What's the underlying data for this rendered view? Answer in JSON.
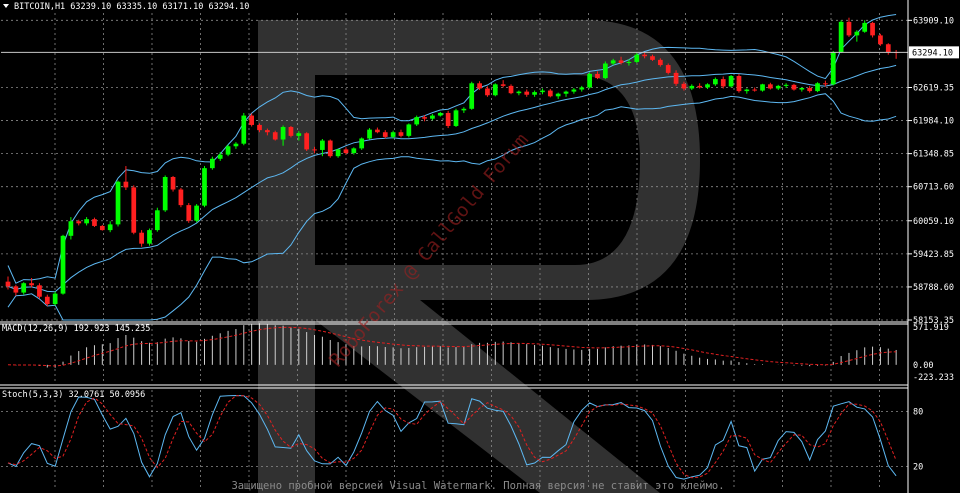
{
  "colors": {
    "background": "#000000",
    "grid": "#8a8a8a",
    "axis_text": "#ffffff",
    "bull": "#00ff00",
    "bear": "#ff2020",
    "bands": "#5db8f2",
    "macd_hist": "#d0d0d0",
    "macd_signal": "#e02020",
    "stoch_main": "#5db8f2",
    "stoch_signal": "#e02020",
    "price_line": "#c8c8c8",
    "watermark_logo": "#3a3a3a",
    "watermark_text": "#a02020"
  },
  "panels": {
    "price": {
      "header": "BITCOIN,H1  63239.10 63335.10 63171.10 63294.10",
      "current_price_label": "63294.10",
      "axis_ticks": [
        "63909.10",
        "62619.35",
        "61984.10",
        "61348.85",
        "60713.60",
        "60059.10",
        "59423.85",
        "58788.60",
        "58153.35"
      ]
    },
    "macd": {
      "header": "MACD(12,26,9) 192.923 145.235",
      "axis_ticks": [
        "571.919",
        "0.00",
        "-223.233"
      ]
    },
    "stoch": {
      "header": "Stoch(5,3,3) 32.0761 50.0956",
      "axis_ticks": [
        "80",
        "20"
      ]
    }
  },
  "watermark": {
    "diagonal_text": "RoboForex @ CallGold Forum",
    "footer_text": "Защищено пробной версией Visual Watermark. Полная версия не ставит это клеймо."
  },
  "chart_data": {
    "type": "candlestick",
    "symbol": "BITCOIN",
    "timeframe": "H1",
    "ylim": [
      58153.35,
      64050
    ],
    "candles": [
      [
        58890,
        58990,
        58740,
        58800
      ],
      [
        58800,
        58830,
        58620,
        58680
      ],
      [
        58680,
        58880,
        58640,
        58860
      ],
      [
        58860,
        58960,
        58780,
        58820
      ],
      [
        58820,
        58860,
        58560,
        58600
      ],
      [
        58600,
        58640,
        58420,
        58460
      ],
      [
        58460,
        58700,
        58430,
        58660
      ],
      [
        58660,
        59790,
        58640,
        59770
      ],
      [
        59770,
        60130,
        59700,
        60050
      ],
      [
        60050,
        60080,
        59970,
        60010
      ],
      [
        60010,
        60130,
        59970,
        60090
      ],
      [
        60090,
        60120,
        59940,
        59960
      ],
      [
        59960,
        59980,
        59870,
        59880
      ],
      [
        59880,
        60050,
        59840,
        59990
      ],
      [
        59990,
        60830,
        59950,
        60810
      ],
      [
        60810,
        61110,
        60650,
        60700
      ],
      [
        60700,
        60740,
        59800,
        59830
      ],
      [
        59830,
        59880,
        59560,
        59620
      ],
      [
        59620,
        59910,
        59580,
        59880
      ],
      [
        59880,
        60310,
        59850,
        60260
      ],
      [
        60260,
        60930,
        60230,
        60900
      ],
      [
        60900,
        60920,
        60620,
        60660
      ],
      [
        60660,
        60690,
        60320,
        60360
      ],
      [
        60360,
        60400,
        60020,
        60060
      ],
      [
        60060,
        60380,
        60030,
        60350
      ],
      [
        60350,
        61110,
        60320,
        61070
      ],
      [
        61070,
        61290,
        61040,
        61250
      ],
      [
        61250,
        61380,
        61210,
        61330
      ],
      [
        61330,
        61520,
        61300,
        61490
      ],
      [
        61490,
        61570,
        61440,
        61540
      ],
      [
        61540,
        62130,
        61510,
        62080
      ],
      [
        62080,
        62120,
        61870,
        61900
      ],
      [
        61900,
        61930,
        61760,
        61800
      ],
      [
        61800,
        61830,
        61700,
        61760
      ],
      [
        61760,
        61790,
        61600,
        61620
      ],
      [
        61620,
        61890,
        61500,
        61860
      ],
      [
        61860,
        61880,
        61660,
        61690
      ],
      [
        61690,
        61780,
        61600,
        61740
      ],
      [
        61740,
        61760,
        61400,
        61430
      ],
      [
        61430,
        61480,
        61360,
        61420
      ],
      [
        61420,
        61630,
        61300,
        61600
      ],
      [
        61600,
        61620,
        61270,
        61300
      ],
      [
        61300,
        61440,
        61270,
        61430
      ],
      [
        61430,
        61470,
        61330,
        61360
      ],
      [
        61360,
        61470,
        61330,
        61450
      ],
      [
        61450,
        61660,
        61420,
        61640
      ],
      [
        61640,
        61840,
        61620,
        61810
      ],
      [
        61810,
        61850,
        61740,
        61760
      ],
      [
        61760,
        61800,
        61640,
        61670
      ],
      [
        61670,
        61790,
        61640,
        61760
      ],
      [
        61760,
        61810,
        61660,
        61690
      ],
      [
        61690,
        61930,
        61660,
        61910
      ],
      [
        61910,
        62080,
        61880,
        62050
      ],
      [
        62050,
        62090,
        61970,
        62020
      ],
      [
        62020,
        62110,
        61990,
        62080
      ],
      [
        62080,
        62150,
        62060,
        62130
      ],
      [
        62130,
        62170,
        61840,
        61880
      ],
      [
        61880,
        62210,
        61860,
        62180
      ],
      [
        62180,
        62240,
        62130,
        62210
      ],
      [
        62210,
        62730,
        62190,
        62700
      ],
      [
        62700,
        62740,
        62570,
        62600
      ],
      [
        62600,
        62640,
        62440,
        62470
      ],
      [
        62470,
        62700,
        62450,
        62680
      ],
      [
        62680,
        62760,
        62620,
        62650
      ],
      [
        62650,
        62680,
        62490,
        62510
      ],
      [
        62510,
        62560,
        62470,
        62540
      ],
      [
        62540,
        62580,
        62440,
        62480
      ],
      [
        62480,
        62560,
        62440,
        62530
      ],
      [
        62530,
        62600,
        62490,
        62560
      ],
      [
        62560,
        62590,
        62430,
        62450
      ],
      [
        62450,
        62520,
        62400,
        62500
      ],
      [
        62500,
        62560,
        62440,
        62540
      ],
      [
        62540,
        62610,
        62500,
        62580
      ],
      [
        62580,
        62650,
        62540,
        62620
      ],
      [
        62620,
        62910,
        62600,
        62880
      ],
      [
        62880,
        62930,
        62780,
        62800
      ],
      [
        62800,
        63120,
        62780,
        63080
      ],
      [
        63080,
        63170,
        63050,
        63140
      ],
      [
        63140,
        63210,
        63060,
        63090
      ],
      [
        63090,
        63160,
        63040,
        63110
      ],
      [
        63110,
        63280,
        63090,
        63250
      ],
      [
        63250,
        63290,
        63180,
        63220
      ],
      [
        63220,
        63250,
        63130,
        63150
      ],
      [
        63150,
        63180,
        63020,
        63050
      ],
      [
        63050,
        63080,
        62870,
        62900
      ],
      [
        62900,
        62950,
        62650,
        62690
      ],
      [
        62690,
        62730,
        62560,
        62600
      ],
      [
        62600,
        62680,
        62570,
        62650
      ],
      [
        62650,
        62700,
        62600,
        62620
      ],
      [
        62620,
        62700,
        62590,
        62680
      ],
      [
        62680,
        62810,
        62650,
        62780
      ],
      [
        62780,
        62830,
        62600,
        62640
      ],
      [
        62640,
        62860,
        62620,
        62840
      ],
      [
        62840,
        62880,
        62520,
        62550
      ],
      [
        62550,
        62600,
        62500,
        62580
      ],
      [
        62580,
        62620,
        62540,
        62560
      ],
      [
        62560,
        62690,
        62540,
        62680
      ],
      [
        62680,
        62710,
        62580,
        62600
      ],
      [
        62600,
        62670,
        62570,
        62650
      ],
      [
        62650,
        62700,
        62610,
        62670
      ],
      [
        62670,
        62690,
        62560,
        62580
      ],
      [
        62580,
        62620,
        62540,
        62610
      ],
      [
        62610,
        62650,
        62520,
        62550
      ],
      [
        62550,
        62720,
        62530,
        62700
      ],
      [
        62700,
        62750,
        62640,
        62680
      ],
      [
        62680,
        63320,
        62660,
        63300
      ],
      [
        63300,
        63910,
        63280,
        63880
      ],
      [
        63880,
        63960,
        63590,
        63620
      ],
      [
        63620,
        63720,
        63500,
        63690
      ],
      [
        63690,
        63910,
        63670,
        63860
      ],
      [
        63860,
        63880,
        63580,
        63620
      ],
      [
        63620,
        63650,
        63420,
        63450
      ],
      [
        63450,
        63470,
        63250,
        63300
      ],
      [
        63300,
        63340,
        63170,
        63294
      ]
    ]
  }
}
